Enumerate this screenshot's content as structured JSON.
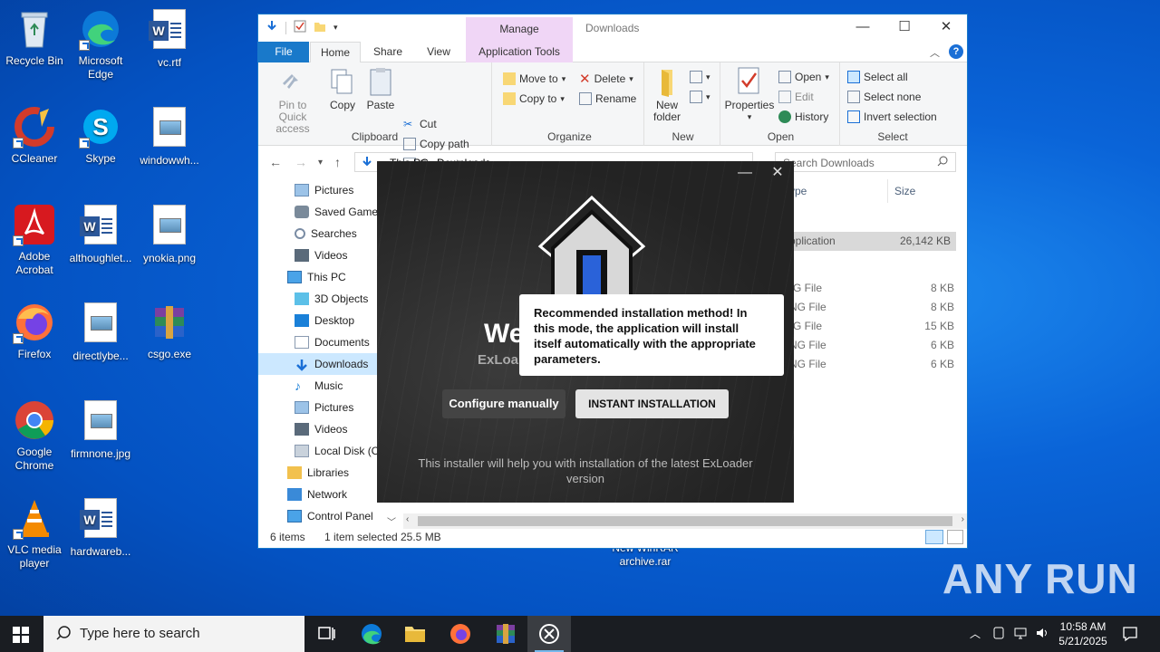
{
  "desktop": {
    "icons": [
      {
        "label": "Recycle Bin"
      },
      {
        "label": "Microsoft Edge"
      },
      {
        "label": "vc.rtf"
      },
      {
        "label": "CCleaner"
      },
      {
        "label": "Skype"
      },
      {
        "label": "windowwh..."
      },
      {
        "label": "Adobe Acrobat"
      },
      {
        "label": "althoughlet..."
      },
      {
        "label": "ynokia.png"
      },
      {
        "label": "Firefox"
      },
      {
        "label": "directlybe..."
      },
      {
        "label": "csgo.exe"
      },
      {
        "label": "Google Chrome"
      },
      {
        "label": "firmnone.jpg"
      },
      {
        "label": "VLC media player"
      },
      {
        "label": "hardwareb..."
      },
      {
        "label": "New WinRAR archive.rar"
      }
    ]
  },
  "explorer": {
    "title": "Downloads",
    "manage_tab": "Manage",
    "tabs": {
      "file": "File",
      "home": "Home",
      "share": "Share",
      "view": "View",
      "app_tools": "Application Tools"
    },
    "ribbon": {
      "clipboard": {
        "label": "Clipboard",
        "pin": "Pin to Quick access",
        "copy": "Copy",
        "paste": "Paste",
        "cut": "Cut",
        "copy_path": "Copy path",
        "paste_shortcut": "Paste shortcut"
      },
      "organize": {
        "label": "Organize",
        "move_to": "Move to",
        "copy_to": "Copy to",
        "delete": "Delete",
        "rename": "Rename"
      },
      "new": {
        "label": "New",
        "new_folder": "New folder"
      },
      "open": {
        "label": "Open",
        "properties": "Properties",
        "open": "Open",
        "edit": "Edit",
        "history": "History"
      },
      "select": {
        "label": "Select",
        "select_all": "Select all",
        "select_none": "Select none",
        "invert": "Invert selection"
      }
    },
    "address": {
      "crumbs": [
        "This PC",
        "Downloads"
      ]
    },
    "search_placeholder": "Search Downloads",
    "nav": [
      {
        "label": "Pictures",
        "icon": "pictures"
      },
      {
        "label": "Saved Games",
        "icon": "games"
      },
      {
        "label": "Searches",
        "icon": "search"
      },
      {
        "label": "Videos",
        "icon": "videos"
      },
      {
        "label": "This PC",
        "icon": "pc"
      },
      {
        "label": "3D Objects",
        "icon": "3d"
      },
      {
        "label": "Desktop",
        "icon": "desktop"
      },
      {
        "label": "Documents",
        "icon": "documents"
      },
      {
        "label": "Downloads",
        "icon": "downloads",
        "selected": true
      },
      {
        "label": "Music",
        "icon": "music"
      },
      {
        "label": "Pictures",
        "icon": "pictures"
      },
      {
        "label": "Videos",
        "icon": "videos"
      },
      {
        "label": "Local Disk (C:)",
        "icon": "disk"
      },
      {
        "label": "Libraries",
        "icon": "libraries"
      },
      {
        "label": "Network",
        "icon": "network"
      },
      {
        "label": "Control Panel",
        "icon": "control"
      }
    ],
    "columns": {
      "type": "ype",
      "size": "Size"
    },
    "files": [
      {
        "type": "pplication",
        "size": "26,142 KB",
        "selected": true
      },
      {
        "type": "G File",
        "size": "8 KB"
      },
      {
        "type": "NG File",
        "size": "8 KB"
      },
      {
        "type": "G File",
        "size": "15 KB"
      },
      {
        "type": "NG File",
        "size": "6 KB"
      },
      {
        "type": "NG File",
        "size": "6 KB"
      }
    ],
    "status": {
      "items": "6 items",
      "selected": "1 item selected",
      "size": "25.5 MB"
    }
  },
  "installer": {
    "welcome": "We",
    "brand": "ExLoa",
    "btn_manual": "Configure manually",
    "btn_instant": "INSTANT INSTALLATION",
    "footer": "This installer will help you with installation of the latest ExLoader version",
    "tooltip": "Recommended installation method! In this mode, the application will install itself automatically with the appropriate parameters."
  },
  "taskbar": {
    "search_placeholder": "Type here to search",
    "time": "10:58 AM",
    "date": "5/21/2025"
  },
  "watermark": "ANY RUN"
}
